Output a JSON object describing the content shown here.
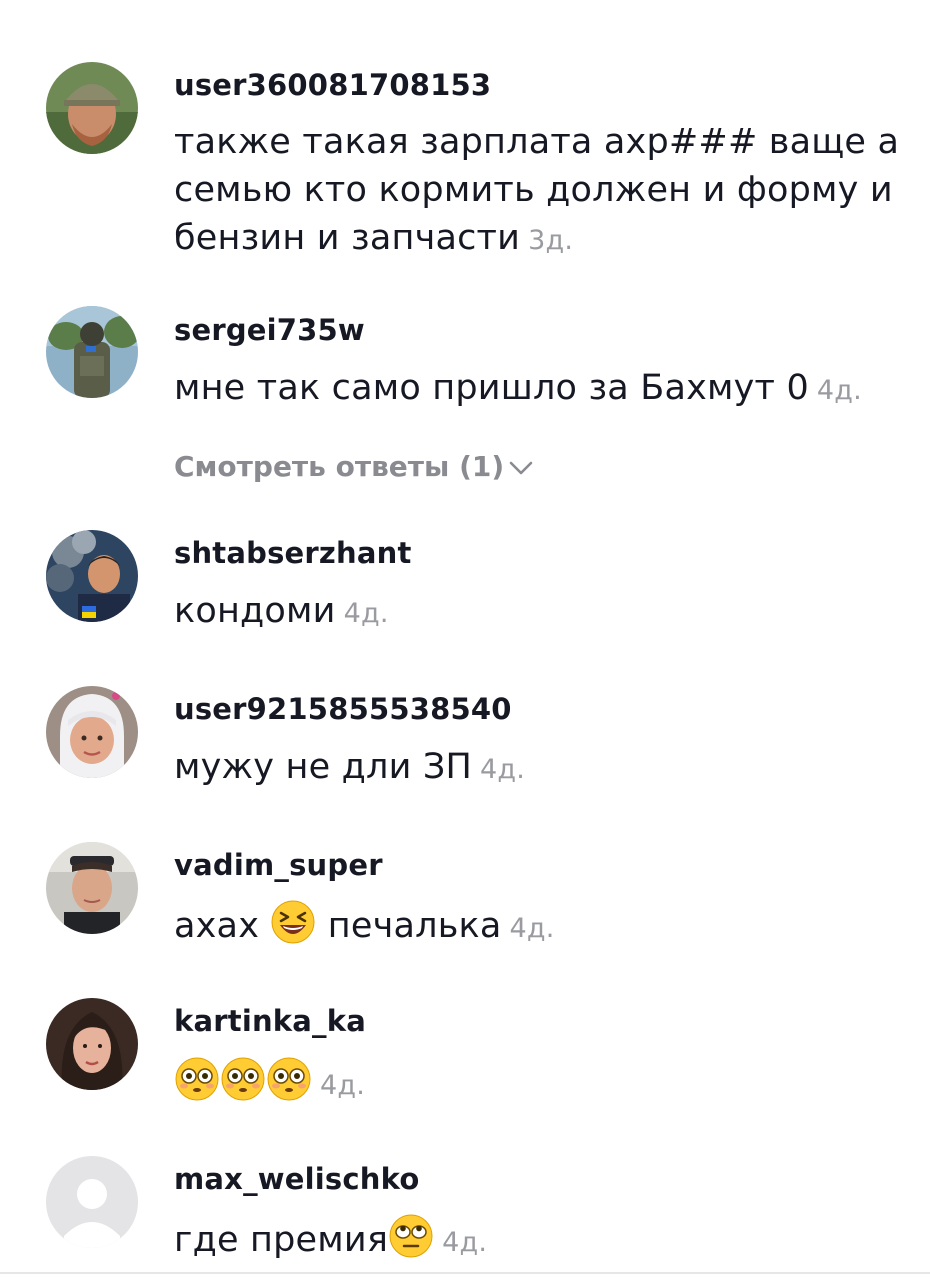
{
  "comments": [
    {
      "username": "user360081708153",
      "text": "также такая зарплата ахр### ваще а семью кто кормить должен и форму и бензин и запчасти",
      "time": "3д.",
      "avatar": "man-in-cap-avatar"
    },
    {
      "username": "sergei735w",
      "text": "мне так само пришло за Бахмут 0",
      "time": "4д.",
      "avatar": "soldier-avatar"
    },
    {
      "username": "shtabserzhant",
      "text": "кондоми",
      "time": "4д.",
      "avatar": "man-with-balloons-avatar"
    },
    {
      "username": "user9215855538540",
      "text": "мужу не дли ЗП",
      "time": "4д.",
      "avatar": "woman-headscarf-avatar"
    },
    {
      "username": "vadim_super",
      "text_before": "ахах",
      "text_after": "печалька",
      "emoji": "laughing-emoji",
      "time": "4д.",
      "avatar": "man-sunglasses-avatar"
    },
    {
      "username": "kartinka_ka",
      "emojis": [
        "flushed-emoji",
        "flushed-emoji",
        "flushed-emoji"
      ],
      "time": "4д.",
      "avatar": "woman-portrait-avatar"
    },
    {
      "username": "max_welischko",
      "text": "где премия",
      "emoji": "eye-roll-emoji",
      "time": "4д.",
      "avatar": "default-avatar"
    }
  ],
  "view_replies": "Смотреть ответы (1)",
  "colors": {
    "text": "#161823",
    "muted": "#9a9ba0",
    "replies": "#8a8b91",
    "emoji_yellow": "#ffcc33"
  }
}
